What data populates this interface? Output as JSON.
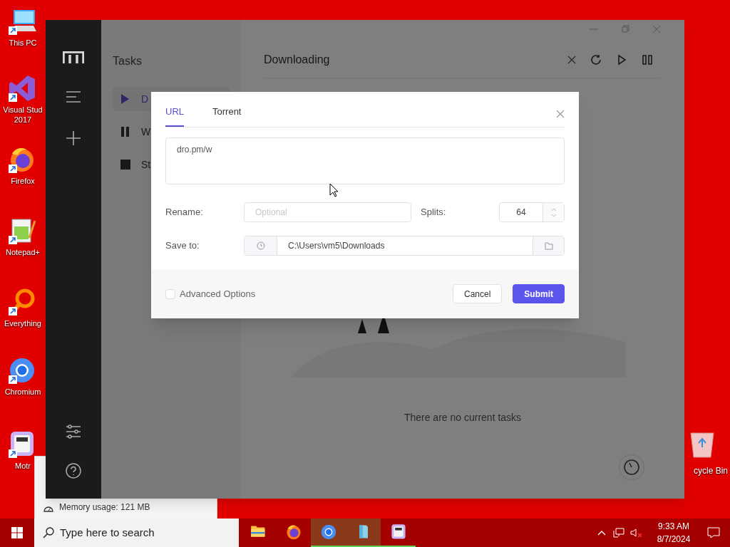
{
  "desktop_icons": [
    {
      "kind": "pc",
      "lines": [
        "This PC"
      ]
    },
    {
      "kind": "vs",
      "lines": [
        "Visual Stud",
        "2017"
      ]
    },
    {
      "kind": "firefox",
      "lines": [
        "Firefox"
      ]
    },
    {
      "kind": "notepad",
      "lines": [
        "Notepad+"
      ]
    },
    {
      "kind": "everything",
      "lines": [
        "Everything"
      ]
    },
    {
      "kind": "chromium",
      "lines": [
        "Chromium"
      ]
    },
    {
      "kind": "motrix",
      "lines": [
        "Motr"
      ]
    }
  ],
  "recycle_bin": {
    "label": "cycle Bin"
  },
  "memory_popup": {
    "text": "Memory usage: 121 MB"
  },
  "app_window": {
    "tasks_panel": {
      "title": "Tasks",
      "items": [
        {
          "kind": "play",
          "label": "D",
          "selected": true
        },
        {
          "kind": "pause",
          "label": "W",
          "selected": false
        },
        {
          "kind": "stop",
          "label": "St",
          "selected": false
        }
      ]
    },
    "main": {
      "title": "Downloading",
      "empty_message": "There are no current tasks"
    }
  },
  "dialog": {
    "tabs": [
      {
        "label": "URL",
        "selected": true
      },
      {
        "label": "Torrent",
        "selected": false
      }
    ],
    "url_field": {
      "value": "dro.pm/w"
    },
    "rename": {
      "label": "Rename:",
      "placeholder": "Optional"
    },
    "splits": {
      "label": "Splits:",
      "value": "64"
    },
    "save_to": {
      "label": "Save to:",
      "value": "C:\\Users\\vm5\\Downloads"
    },
    "advanced_options": {
      "label": "Advanced Options",
      "checked": false
    },
    "buttons": [
      {
        "kind": "secondary",
        "label": "Cancel"
      },
      {
        "kind": "primary",
        "label": "Submit"
      }
    ]
  },
  "taskbar": {
    "search": {
      "placeholder": "Type here to search"
    },
    "apps": [
      {
        "kind": "explorer",
        "running": false,
        "highlighted": false
      },
      {
        "kind": "firefox",
        "running": false,
        "highlighted": false
      },
      {
        "kind": "chromium",
        "running": true,
        "highlighted": true
      },
      {
        "kind": "app",
        "running": true,
        "highlighted": true
      },
      {
        "kind": "motrix",
        "running": true,
        "highlighted": false
      }
    ],
    "clock": {
      "time": "9:33 AM",
      "date": "8/7/2024"
    }
  }
}
